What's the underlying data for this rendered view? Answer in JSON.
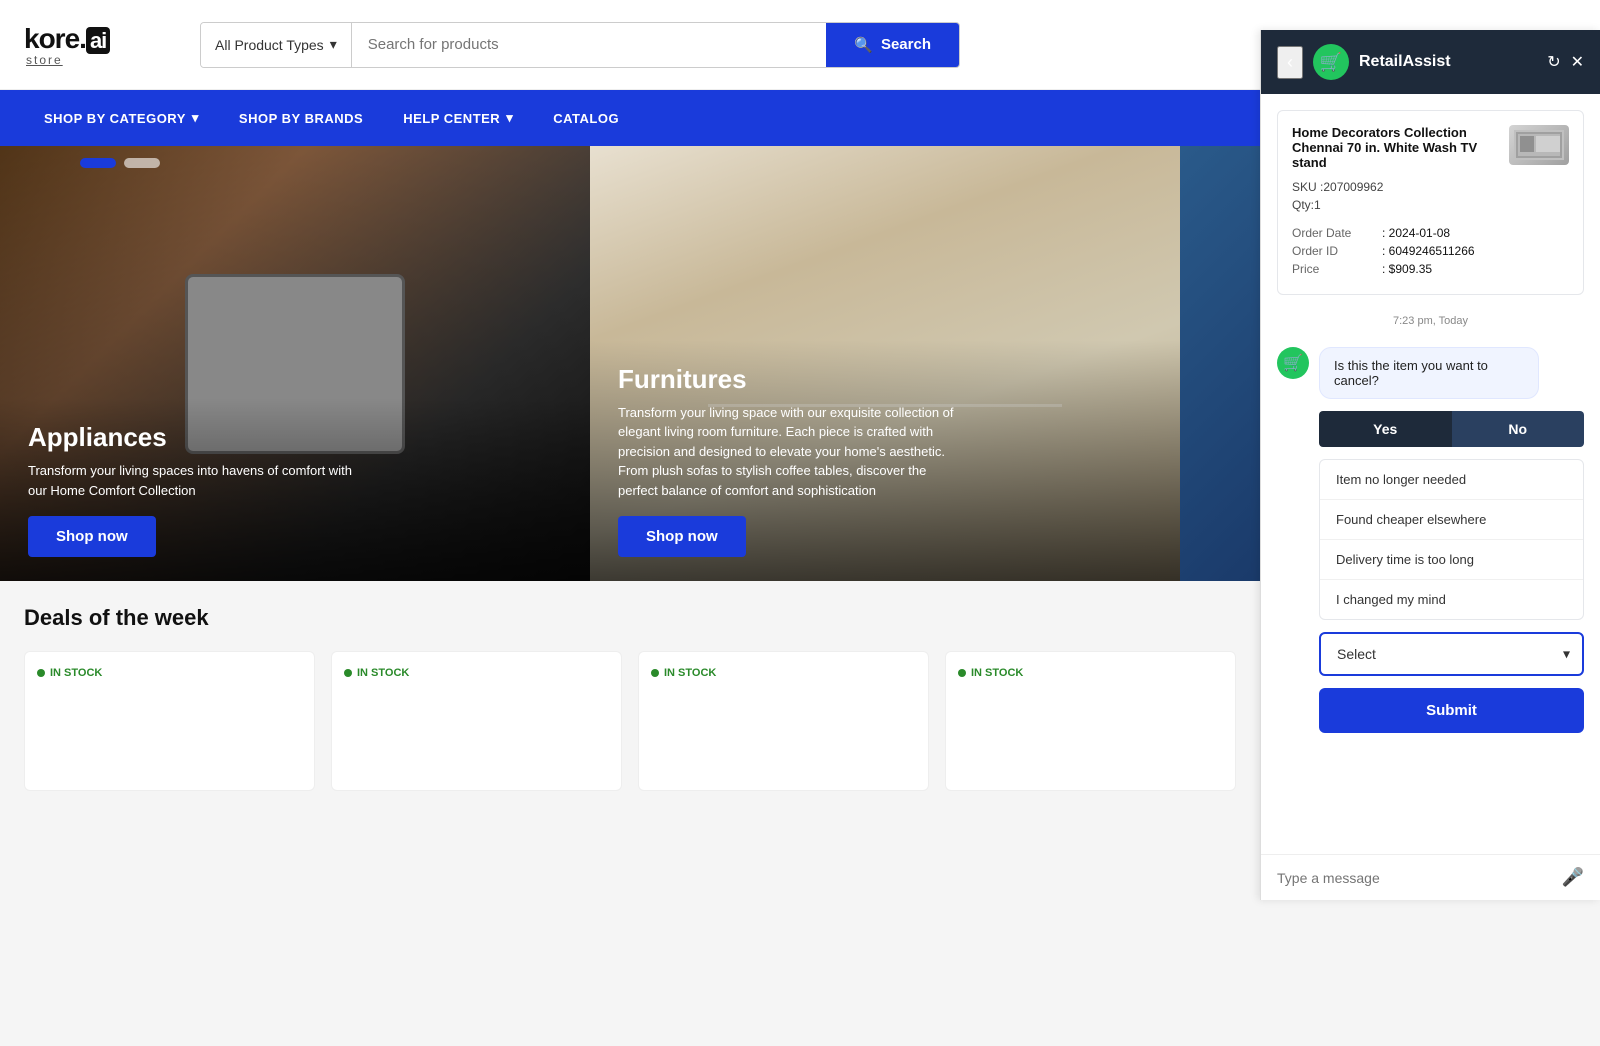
{
  "header": {
    "logo": "kore.",
    "logo_ai": "ai",
    "logo_sub": "store",
    "search_placeholder": "Search for products",
    "all_product_types": "All Product Types",
    "search_label": "Search"
  },
  "nav": {
    "items": [
      {
        "label": "SHOP BY CATEGORY",
        "has_dropdown": true
      },
      {
        "label": "SHOP BY BRANDS",
        "has_dropdown": false
      },
      {
        "label": "HELP CENTER",
        "has_dropdown": true
      },
      {
        "label": "CATALOG",
        "has_dropdown": false
      }
    ]
  },
  "carousel": {
    "cards": [
      {
        "id": "appliances",
        "title": "Appliances",
        "description": "Transform your living spaces into havens of comfort with our Home Comfort Collection",
        "shop_now": "Shop now"
      },
      {
        "id": "furnitures",
        "title": "Furnitures",
        "description": "Transform your living space with our exquisite collection of elegant living room furniture. Each piece is crafted with precision and designed to elevate your home's aesthetic. From plush sofas to stylish coffee tables, discover the perfect balance of comfort and sophistication",
        "shop_now": "Shop now"
      }
    ]
  },
  "deals": {
    "title": "Deals of the week",
    "in_stock_label": "IN STOCK",
    "cards": [
      {
        "id": "deal1"
      },
      {
        "id": "deal2"
      },
      {
        "id": "deal3"
      },
      {
        "id": "deal4"
      }
    ]
  },
  "chat": {
    "header": {
      "title": "RetailAssist",
      "back_label": "‹",
      "refresh_icon": "↻",
      "close_icon": "✕"
    },
    "product": {
      "name": "Home Decorators Collection Chennai 70 in. White Wash TV stand",
      "sku_label": "SKU :",
      "sku": "207009962",
      "qty_label": "Qty:",
      "qty": "1",
      "order_date_label": "Order Date",
      "order_date": ": 2024-01-08",
      "order_id_label": "Order ID",
      "order_id": ": 6049246511266",
      "price_label": "Price",
      "price": ": $909.35"
    },
    "timestamp": "7:23 pm, Today",
    "bot_question": "Is this the item you want to cancel?",
    "yes_label": "Yes",
    "no_label": "No",
    "cancel_reasons": [
      "Item no longer needed",
      "Found cheaper elsewhere",
      "Delivery time is too long",
      "I changed my mind"
    ],
    "select_placeholder": "Select",
    "submit_label": "Submit",
    "input_placeholder": "Type a message"
  }
}
